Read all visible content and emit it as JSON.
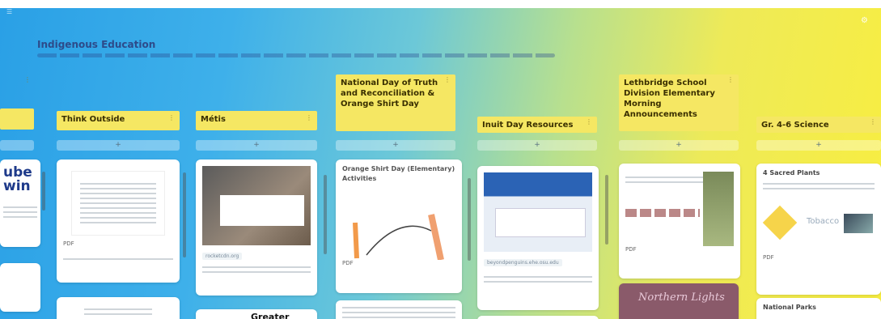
{
  "board": {
    "breadcrumb": "",
    "title": "Indigenous Education",
    "settings_icon": "gear-icon"
  },
  "columns": [
    {
      "title": "Think Outside"
    },
    {
      "title": "Métis"
    },
    {
      "title": "National Day of Truth and Reconciliation & Orange Shirt Day"
    },
    {
      "title": "Inuit Day Resources"
    },
    {
      "title": "Lethbridge School Division Elementary Morning Announcements"
    },
    {
      "title": "Gr. 4-6 Science"
    }
  ],
  "add_label": "+",
  "cards": {
    "left_partial_text": "ube\nwin",
    "think_outside_pdf": "PDF",
    "metis_url": "rocketcdn.org",
    "metis_logo": "Greater\nVICTORIA",
    "orange_title": "Orange Shirt Day (Elementary) Activities",
    "orange_pdf": "PDF",
    "inuit_url": "beyondpenguins.ehe.osu.edu",
    "lethbridge_pdf": "PDF",
    "lethbridge_video": "Northern Lights",
    "science_card1": "4 Sacred Plants",
    "science_pdf": "PDF",
    "science_card2": "National Parks",
    "tobacco": "Tobacco"
  }
}
